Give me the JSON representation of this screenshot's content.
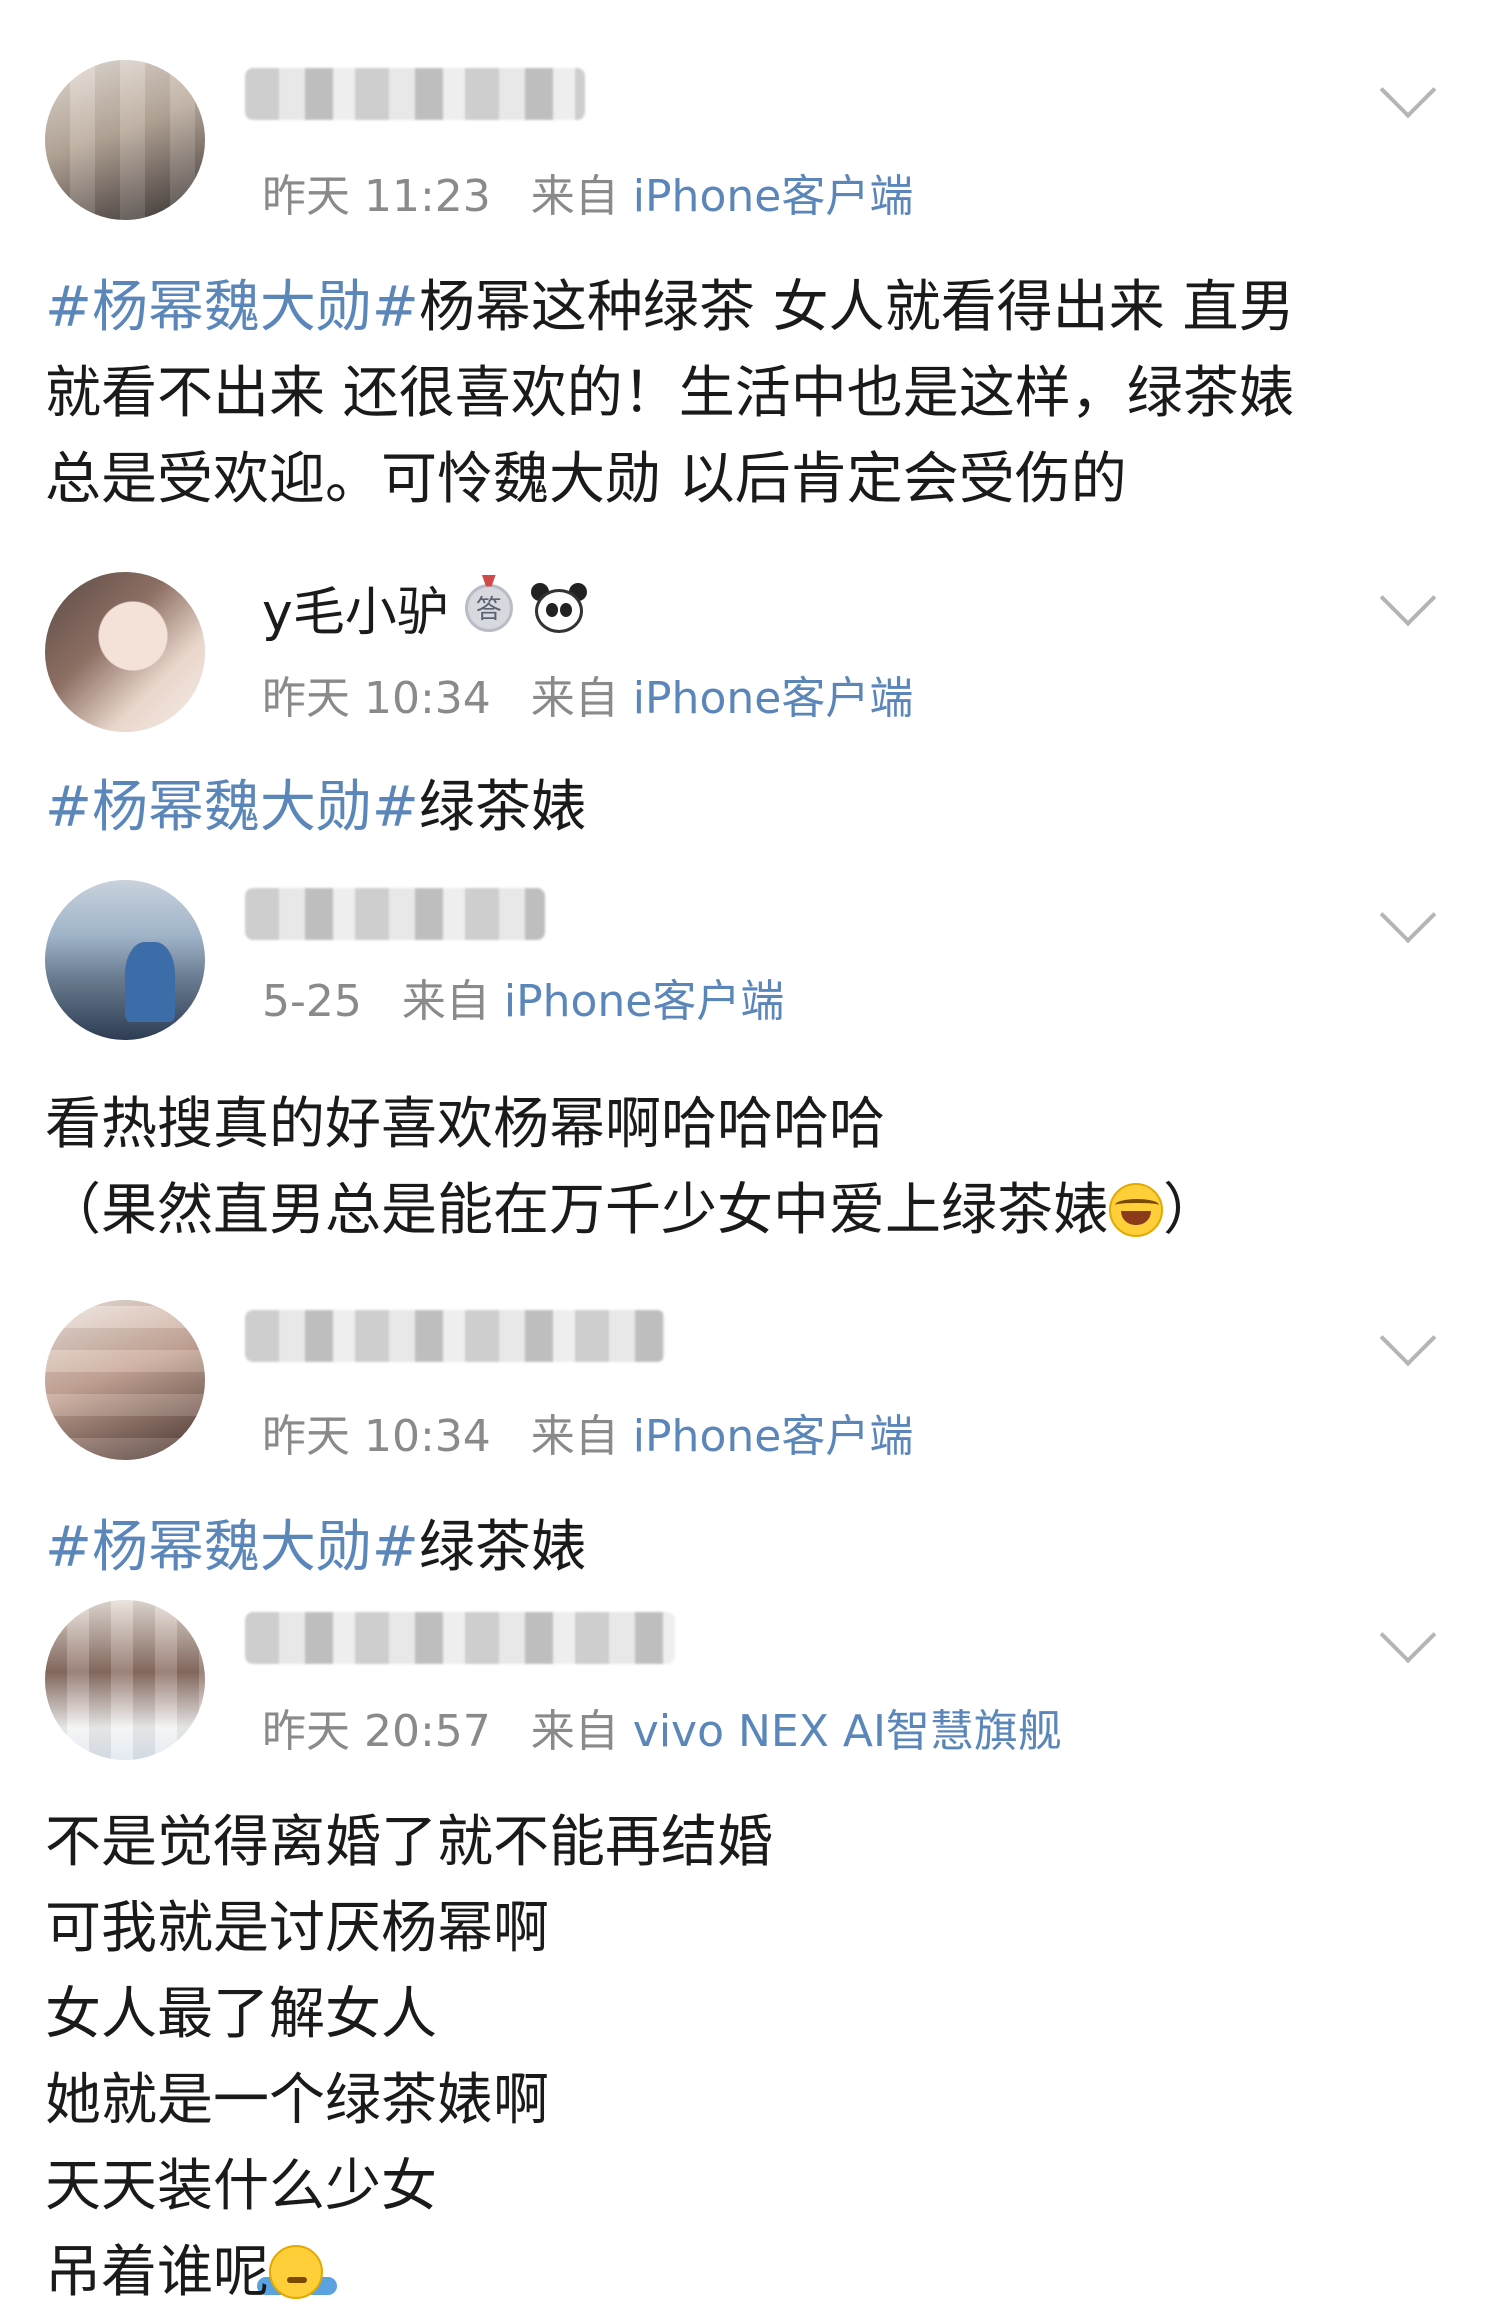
{
  "posts": [
    {
      "meta_time": "昨天 11:23",
      "meta_from": "来自",
      "meta_source": "iPhone客户端",
      "text_tag": "#杨幂魏大勋#",
      "text_lines": [
        "杨幂这种绿茶 女人就看得出来 直男",
        "就看不出来 还很喜欢的！生活中也是这样，绿茶婊",
        "总是受欢迎。可怜魏大勋 以后肯定会受伤的"
      ]
    },
    {
      "username": "y毛小驴",
      "badge_text": "答",
      "meta_time": "昨天 10:34",
      "meta_from": "来自",
      "meta_source": "iPhone客户端",
      "text_tag": "#杨幂魏大勋#",
      "text_rest": "绿茶婊"
    },
    {
      "meta_time": "5-25",
      "meta_from": "来自",
      "meta_source": "iPhone客户端",
      "text_lines": [
        "看热搜真的好喜欢杨幂啊哈哈哈哈",
        "（果然直男总是能在万千少女中爱上绿茶婊",
        "）"
      ]
    },
    {
      "meta_time": "昨天 10:34",
      "meta_from": "来自",
      "meta_source": "iPhone客户端",
      "text_tag": "#杨幂魏大勋#",
      "text_rest": "绿茶婊"
    },
    {
      "meta_time": "昨天 20:57",
      "meta_from": "来自",
      "meta_source": "vivo NEX AI智慧旗舰",
      "text_lines": [
        "不是觉得离婚了就不能再结婚",
        "可我就是讨厌杨幂啊",
        "女人最了解女人",
        "她就是一个绿茶婊啊",
        "天天装什么少女",
        "吊着谁呢"
      ]
    }
  ],
  "icons": {
    "chevron": "chevron-down-icon",
    "badge": "answer-medal-icon",
    "panda": "panda-icon",
    "emoji_laugh": "laugh-cry-emoji",
    "emoji_shrug": "shrug-emoji"
  },
  "colors": {
    "link": "#5b86b9",
    "meta": "#8a8a8a",
    "text": "#1a1a1a"
  }
}
